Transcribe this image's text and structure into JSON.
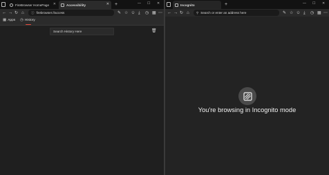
{
  "left_window": {
    "tabs": [
      {
        "label": "FireBrowser HomePage",
        "active": false
      },
      {
        "label": "Accessibility",
        "active": true
      }
    ],
    "new_tab_symbol": "+",
    "tab_close_symbol": "✕",
    "window_controls": [
      "—",
      "☐",
      "✕"
    ],
    "address": "firebrowser://access",
    "bookmarks": [
      {
        "label": "Apps",
        "icon": "apps-grid-icon"
      },
      {
        "label": "History",
        "icon": "history-clock-icon",
        "selected": true
      }
    ],
    "search_history_placeholder": "Search History Here",
    "accent_color": "#e84b3c"
  },
  "right_window": {
    "tabs": [
      {
        "label": "Incognito",
        "active": true
      }
    ],
    "new_tab_symbol": "+",
    "window_controls": [
      "—",
      "☐",
      "✕"
    ],
    "address_placeholder": "Search or enter an address here",
    "incognito_message": "You're browsing in Incognito mode"
  }
}
